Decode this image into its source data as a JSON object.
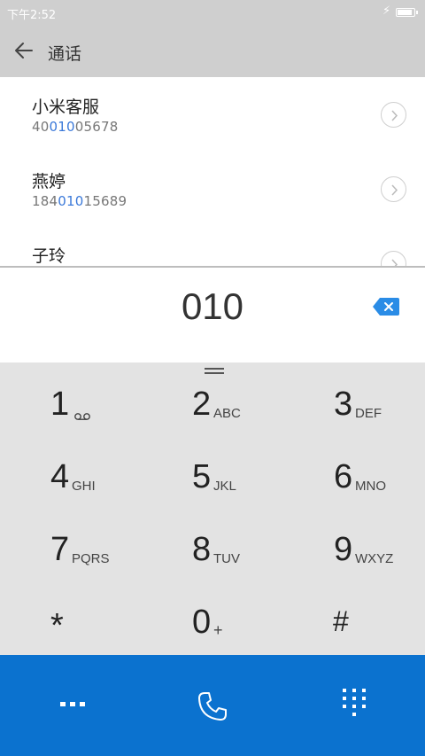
{
  "status_bar": {
    "time": "下午2:52",
    "charging_symbol": "⚡",
    "battery_level": 0.9
  },
  "header": {
    "title": "通话",
    "back_icon": "arrow-left-icon"
  },
  "contacts": [
    {
      "name": "小米客服",
      "number_pre": "40",
      "number_match": "010",
      "number_post": "05678"
    },
    {
      "name": "燕婷",
      "number_pre": "184",
      "number_match": "010",
      "number_post": "15689"
    },
    {
      "name": "子玲",
      "number_pre": "",
      "number_match": "",
      "number_post": ""
    }
  ],
  "dialed": "010",
  "keys": [
    {
      "digit": "1",
      "letters": "",
      "icon": "voicemail-icon"
    },
    {
      "digit": "2",
      "letters": "ABC"
    },
    {
      "digit": "3",
      "letters": "DEF"
    },
    {
      "digit": "4",
      "letters": "GHI"
    },
    {
      "digit": "5",
      "letters": "JKL"
    },
    {
      "digit": "6",
      "letters": "MNO"
    },
    {
      "digit": "7",
      "letters": "PQRS"
    },
    {
      "digit": "8",
      "letters": "TUV"
    },
    {
      "digit": "9",
      "letters": "WXYZ"
    },
    {
      "digit": "*",
      "letters": ""
    },
    {
      "digit": "0",
      "letters": "+"
    },
    {
      "digit": "#",
      "letters": ""
    }
  ],
  "bottom_bar": {
    "more_icon": "more-icon",
    "call_icon": "phone-icon",
    "keypad_icon": "dialpad-icon"
  },
  "colors": {
    "accent": "#0b72cf",
    "highlight": "#3b79d9",
    "header_bg": "#cfcfcf",
    "keypad_bg": "#e3e3e3"
  }
}
